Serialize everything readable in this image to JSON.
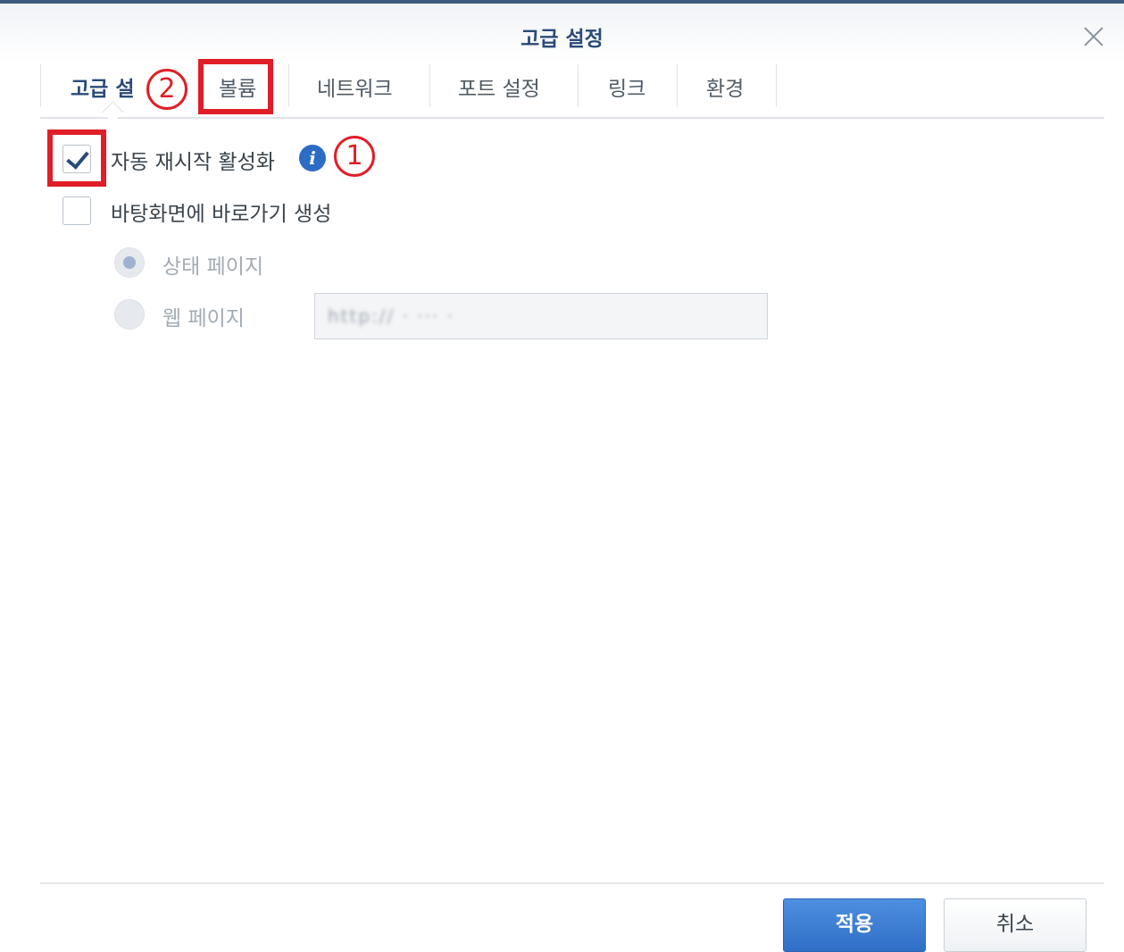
{
  "dialog": {
    "title": "고급 설정"
  },
  "tabs": [
    {
      "label": "고급 설정"
    },
    {
      "label": "볼륨"
    },
    {
      "label": "네트워크"
    },
    {
      "label": "포트 설정"
    },
    {
      "label": "링크"
    },
    {
      "label": "환경"
    }
  ],
  "annotations": {
    "one": "1",
    "two": "2"
  },
  "options": {
    "auto_restart": {
      "label": "자동 재시작 활성화",
      "checked": true,
      "info_icon": "i"
    },
    "desktop_shortcut": {
      "label": "바탕화면에 바로가기 생성",
      "checked": false
    },
    "status_page": {
      "label": "상태 페이지",
      "selected": true
    },
    "web_page": {
      "label": "웹 페이지",
      "selected": false,
      "url_value": "http://  ·  ···  ·"
    }
  },
  "footer": {
    "apply_label": "적용",
    "cancel_label": "취소"
  },
  "colors": {
    "accent": "#2f6fc6",
    "title": "#2a4a78",
    "annotation": "#e01e27"
  }
}
